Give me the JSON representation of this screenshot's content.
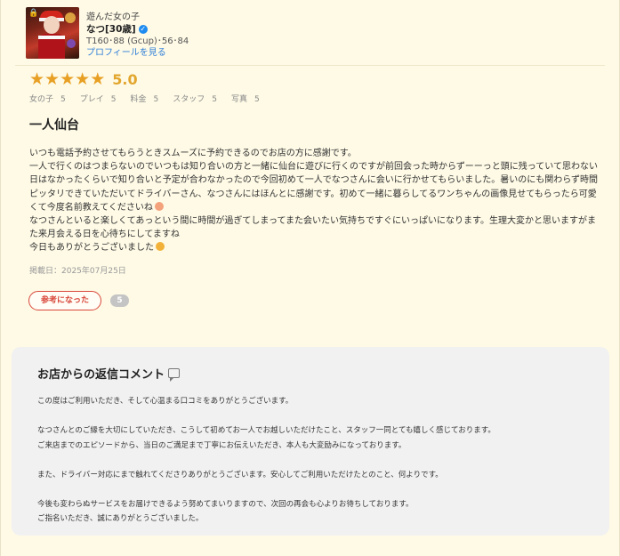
{
  "profile": {
    "category": "遊んだ女の子",
    "name": "なつ[30歳]",
    "spec": "T160･88 (Gcup)･56･84",
    "link": "プロフィールを見る"
  },
  "rating": {
    "stars": 5,
    "score": "5.0",
    "subscores": [
      {
        "label": "女の子",
        "value": "5"
      },
      {
        "label": "プレイ",
        "value": "5"
      },
      {
        "label": "料金",
        "value": "5"
      },
      {
        "label": "スタッフ",
        "value": "5"
      },
      {
        "label": "写真",
        "value": "5"
      }
    ]
  },
  "review": {
    "title": "一人仙台",
    "lines": [
      "いつも電話予約させてもらうときスムーズに予約できるのでお店の方に感謝です。",
      "一人で行くのはつまらないのでいつもは知り合いの方と一緒に仙台に遊びに行くのですが前回会った時からずーーっと頭に残っていて思わない",
      "日はなかったくらいで知り合いと予定が合わなかったので今回初めて一人でなつさんに会いに行かせてもらいました。暑いのにも関わらず時間",
      "ピッタリできていただいてドライバーさん、なつさんにはほんとに感謝です。初めて一緒に暮らしてるワンちゃんの画像見せてもらったら可愛",
      "くて今度名前教えてくださいね",
      "なつさんといると楽しくてあっという間に時間が過ぎてしまってまた会いたい気持ちですぐにいっぱいになります。生理大変かと思いますがま",
      "た来月会える日を心待ちにしてますね",
      "今日もありがとうございました"
    ],
    "date": "掲載日：2025年07月25日",
    "helpful_label": "参考になった",
    "helpful_count": "5"
  },
  "reply": {
    "title": "お店からの返信コメント",
    "lines": [
      "この度はご利用いただき、そして心温まる口コミをありがとうございます。",
      "",
      "なつさんとのご縁を大切にしていただき、こうして初めてお一人でお越しいただけたこと、スタッフ一同とても嬉しく感じております。",
      "ご来店までのエピソードから、当日のご満足まで丁寧にお伝えいただき、本人も大変励みになっております。",
      "",
      "また、ドライバー対応にまで触れてくださりありがとうございます。安心してご利用いただけたとのこと、何よりです。",
      "",
      "今後も変わらぬサービスをお届けできるよう努めてまいりますので、次回の再会も心よりお待ちしております。",
      "ご指名いただき、誠にありがとうございました。"
    ]
  },
  "colors": {
    "background": "#fefae6",
    "star": "#e8a024",
    "accent_red": "#d9473b",
    "link": "#2f7fd8",
    "reply_bg": "#f1f1f1"
  }
}
